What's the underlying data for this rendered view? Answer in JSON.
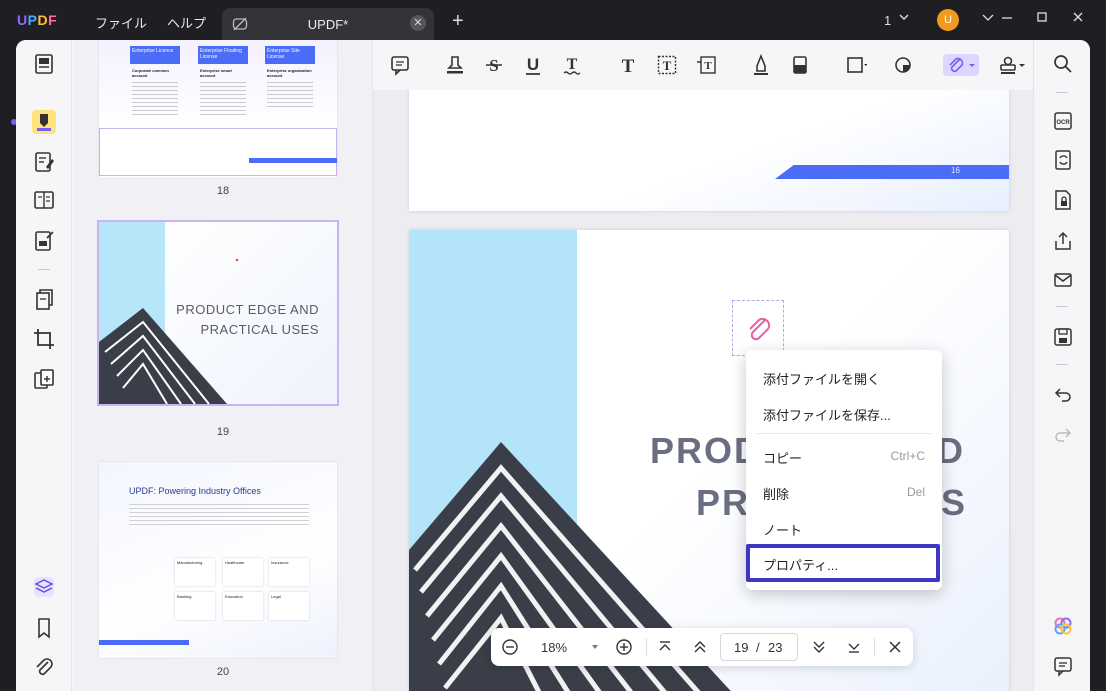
{
  "app": {
    "logo": [
      "U",
      "P",
      "D",
      "F"
    ],
    "menu_file": "ファイル",
    "menu_help": "ヘルプ",
    "tab_title": "UPDF*",
    "tab_close": "✕",
    "new_tab": "+",
    "page_count_indicator": "1",
    "avatar_initial": "U"
  },
  "thumbnails": [
    {
      "label": "18",
      "columns": [
        {
          "head": "Enterprise Licence",
          "sub": "Corporate common account"
        },
        {
          "head": "Enterprise Floating License",
          "sub": "Enterprise smart account"
        },
        {
          "head": "Enterprise Site License",
          "sub": "Enterprise organization account"
        }
      ]
    },
    {
      "label": "19",
      "title_line1": "PRODUCT EDGE AND",
      "title_line2": "PRACTICAL USES"
    },
    {
      "label": "20",
      "title": "UPDF: Powering Industry Offices",
      "industries": [
        "Manufacturing",
        "Healthcare",
        "Insurance",
        "Banking",
        "Education",
        "Legal"
      ]
    }
  ],
  "document": {
    "prev_page_number": "16",
    "heading_line1": "PRODUC",
    "heading_line1_tail": "D",
    "heading_line2": "PRA",
    "heading_line2_tail": "S"
  },
  "context_menu": {
    "items": [
      {
        "label": "添付ファイルを開く",
        "shortcut": ""
      },
      {
        "label": "添付ファイルを保存...",
        "shortcut": ""
      },
      {
        "label": "コピー",
        "shortcut": "Ctrl+C"
      },
      {
        "label": "削除",
        "shortcut": "Del"
      },
      {
        "label": "ノート",
        "shortcut": ""
      },
      {
        "label": "プロパティ...",
        "shortcut": ""
      }
    ]
  },
  "zoom": {
    "zoom_level": "18%",
    "current_page": "19",
    "page_separator": "/",
    "total_pages": "23"
  },
  "colors": {
    "accent": "#7b5cf0",
    "highlight_border": "#3d37c4",
    "page_blue": "#4a6cf7",
    "avatar": "#f39a1e"
  }
}
